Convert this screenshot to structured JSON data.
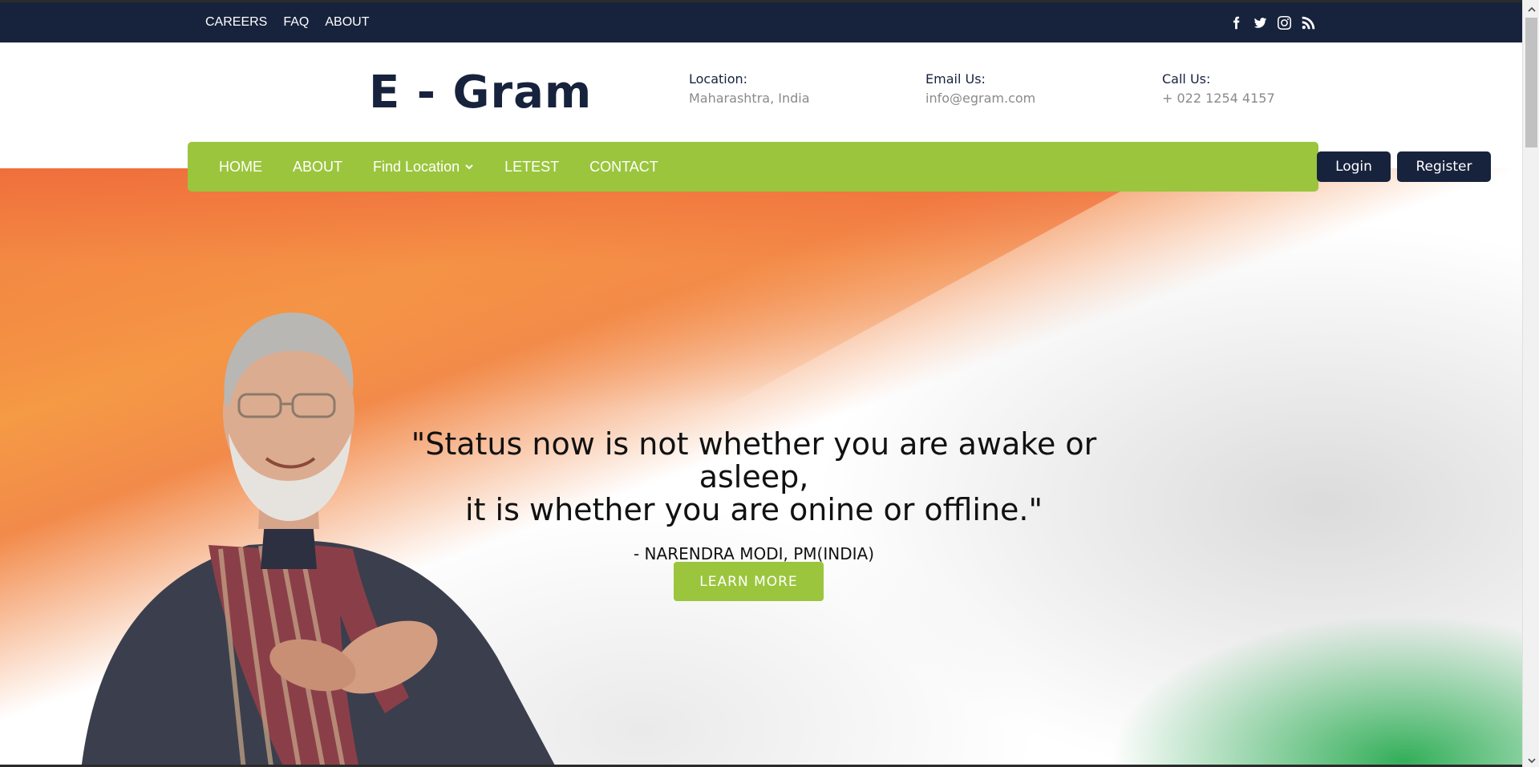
{
  "topbar": {
    "links": [
      "CAREERS",
      "FAQ",
      "ABOUT"
    ],
    "social_icons": [
      "facebook-icon",
      "twitter-icon",
      "instagram-icon",
      "rss-icon"
    ]
  },
  "header": {
    "logo": "E - Gram",
    "location": {
      "label": "Location:",
      "value": "Maharashtra, India"
    },
    "email": {
      "label": "Email Us:",
      "value": "info@egram.com"
    },
    "call": {
      "label": "Call Us:",
      "value": "+ 022 1254 4157"
    }
  },
  "nav": {
    "items": [
      "HOME",
      "ABOUT",
      "Find Location",
      "LETEST",
      "CONTACT"
    ],
    "login": "Login",
    "register": "Register"
  },
  "hero": {
    "quote_line1": "\"Status now is not whether you are awake or asleep,",
    "quote_line2": "it is whether you are onine or offline.\"",
    "author": "- NARENDRA MODI, PM(INDIA)",
    "cta": "LEARN MORE"
  },
  "colors": {
    "navy": "#17223d",
    "green": "#9bc53d",
    "saffron": "#f28a4a",
    "flag_green": "#28aa50"
  }
}
